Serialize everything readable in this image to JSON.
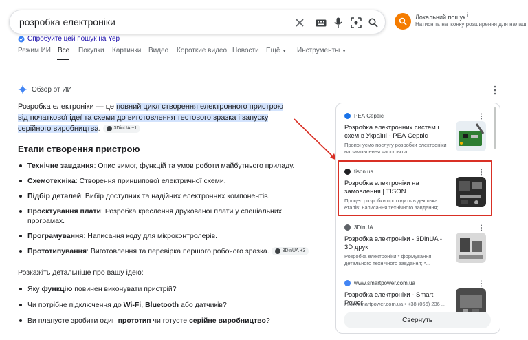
{
  "search": {
    "query": "розробка електроніки"
  },
  "extension": {
    "title": "Локальний пошук",
    "title_mark": "i",
    "subtitle": "Натисніть на іконку розширення для налаш"
  },
  "try_yep": "Спробуйте цей пошук на Yep",
  "tabs": [
    {
      "label": "Режим ИИ"
    },
    {
      "label": "Все"
    },
    {
      "label": "Покупки"
    },
    {
      "label": "Картинки"
    },
    {
      "label": "Видео"
    },
    {
      "label": "Короткие видео"
    },
    {
      "label": "Новости"
    },
    {
      "label": "Ещё"
    },
    {
      "label": "Инструменты"
    }
  ],
  "ai_overview": {
    "heading": "Обзор от ИИ",
    "intro_prefix": "Розробка електроніки — це ",
    "intro_highlight": "повний цикл створення електронного пристрою від початкової ідеї та схеми до виготовлення тестового зразка і запуску серійного виробництва",
    "intro_suffix": ".",
    "intro_chip": "3DinUA +1",
    "section_title": "Етапи створення пристрою",
    "steps": [
      {
        "term": "Технічне завдання",
        "text": ": Опис вимог, функцій та умов роботи майбутнього приладу."
      },
      {
        "term": "Схемотехніка",
        "text": ": Створення принципової електричної схеми."
      },
      {
        "term": "Підбір деталей",
        "text": ": Вибір доступних та надійних електронних компонентів."
      },
      {
        "term": "Проєктування плати",
        "text": ": Розробка креслення друкованої плати у спеціальних програмах."
      },
      {
        "term": "Програмування",
        "text": ": Написання коду для мікроконтролерів."
      },
      {
        "term": "Прототипування",
        "text": ": Виготовлення та перевірка першого робочого зразка."
      }
    ],
    "steps_chip": "3DinUA +3",
    "ask_label": "Розкажіть детальніше про вашу ідею:",
    "questions": [
      {
        "pre": "Яку ",
        "bold1": "функцію",
        "mid": " повинен виконувати пристрій?",
        "bold2": "",
        "post": ""
      },
      {
        "pre": "Чи потрібне підключення до ",
        "bold1": "Wi-Fi",
        "mid": ", ",
        "bold2": "Bluetooth",
        "post": " або датчиків?"
      },
      {
        "pre": "Ви плануєте зробити один ",
        "bold1": "прототип",
        "mid": " чи готуєте ",
        "bold2": "серійне виробництво",
        "post": "?"
      }
    ]
  },
  "sources": [
    {
      "site": "РЕА Сервіс",
      "title": "Розробка електронних систем і схем в Україні - РЕА Сервіс",
      "snippet": "Пропонуємо послугу розробки електроніки на замовлення частково а...",
      "fav_color": "#1a73e8"
    },
    {
      "site": "tison.ua",
      "title": "Розробка електроніки на замовлення | TISON",
      "snippet": "Процес розробки проходить в декілька етапів: написання технічного завдання;...",
      "fav_color": "#202124"
    },
    {
      "site": "3DinUA",
      "title": "Розробка електроніки - 3DinUA - 3D друк",
      "snippet": "Розробка електроніки * формування детального технічного завдання; *...",
      "fav_color": "#5f6368"
    },
    {
      "site": "www.smartpower.com.ua",
      "title": "Розробка електроніки - Smart Power",
      "snippet": "info@smartpower.com.ua • +38 (066) 236 ...",
      "fav_color": "#4285f4"
    }
  ],
  "expand_label": "Свернуть"
}
